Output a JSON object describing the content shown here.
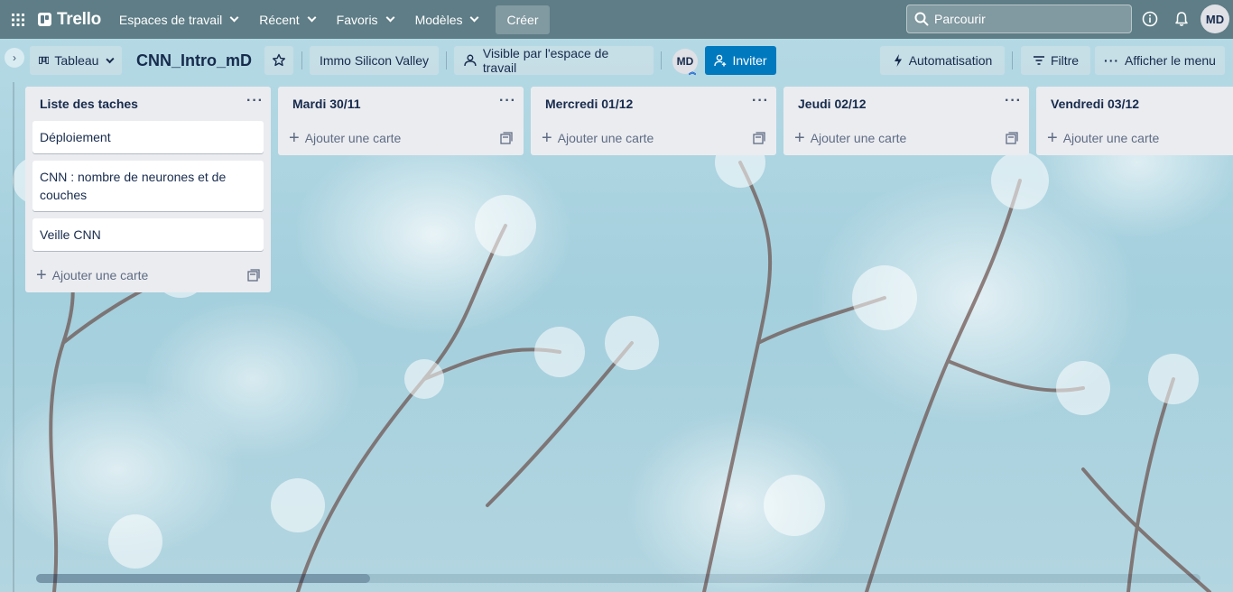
{
  "topnav": {
    "apps_icon": "grid-icon",
    "logo": "Trello",
    "menus": [
      {
        "label": "Espaces de travail"
      },
      {
        "label": "Récent"
      },
      {
        "label": "Favoris"
      },
      {
        "label": "Modèles"
      }
    ],
    "create_label": "Créer",
    "search_placeholder": "Parcourir",
    "avatar_initials": "MD"
  },
  "boardbar": {
    "view_label": "Tableau",
    "board_title": "CNN_Intro_mD",
    "workspace_label": "Immo Silicon Valley",
    "visibility_label": "Visible par l'espace de travail",
    "member_initials": "MD",
    "invite_label": "Inviter",
    "automation_label": "Automatisation",
    "filter_label": "Filtre",
    "menu_label": "Afficher le menu"
  },
  "lists": [
    {
      "title": "Liste des taches",
      "cards": [
        "Déploiement",
        "CNN : nombre de neurones et de couches",
        "Veille CNN"
      ],
      "add_label": "Ajouter une carte"
    },
    {
      "title": "Mardi 30/11",
      "cards": [],
      "add_label": "Ajouter une carte"
    },
    {
      "title": "Mercredi 01/12",
      "cards": [],
      "add_label": "Ajouter une carte"
    },
    {
      "title": "Jeudi 02/12",
      "cards": [],
      "add_label": "Ajouter une carte"
    },
    {
      "title": "Vendredi 03/12",
      "cards": [],
      "add_label": "Ajouter une carte"
    }
  ],
  "colors": {
    "topnav_bg": "#526f79",
    "invite_bg": "#0079bf",
    "list_bg": "#ebecf0"
  }
}
